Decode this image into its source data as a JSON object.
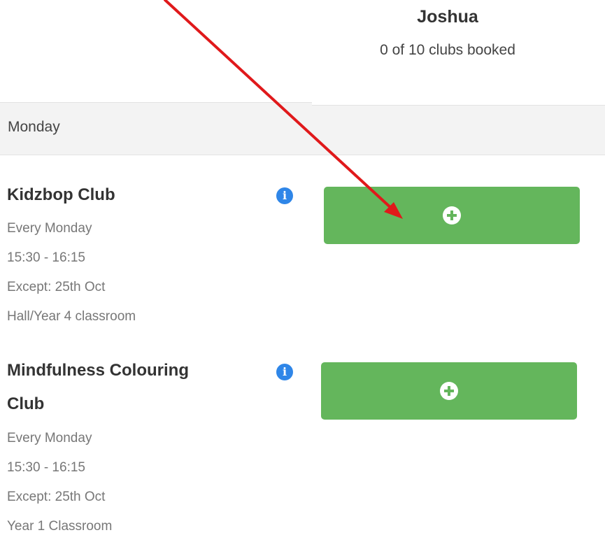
{
  "header": {
    "child_name": "Joshua",
    "booked_count": "0 of 10 clubs booked"
  },
  "day": {
    "label": "Monday"
  },
  "clubs": [
    {
      "title_line1": "Kidzbop Club",
      "title_line2": "",
      "frequency": "Every Monday",
      "time": "15:30 - 16:15",
      "exception": "Except:  25th Oct",
      "location": "Hall/Year 4 classroom",
      "info_icon": "info-icon",
      "book_icon": "plus-circle-icon"
    },
    {
      "title_line1": "Mindfulness Colouring",
      "title_line2": "Club",
      "frequency": "Every Monday",
      "time": "15:30 - 16:15",
      "exception": "Except:  25th Oct",
      "location": "Year 1 Classroom",
      "info_icon": "info-icon",
      "book_icon": "plus-circle-icon"
    }
  ],
  "colors": {
    "book_button": "#64b65c",
    "info_icon": "#2f86e8",
    "annotation_arrow": "#e0191b",
    "day_band": "#f3f3f3"
  },
  "annotation": {
    "type": "red-arrow",
    "points_to": "kidzbop-book-button"
  }
}
